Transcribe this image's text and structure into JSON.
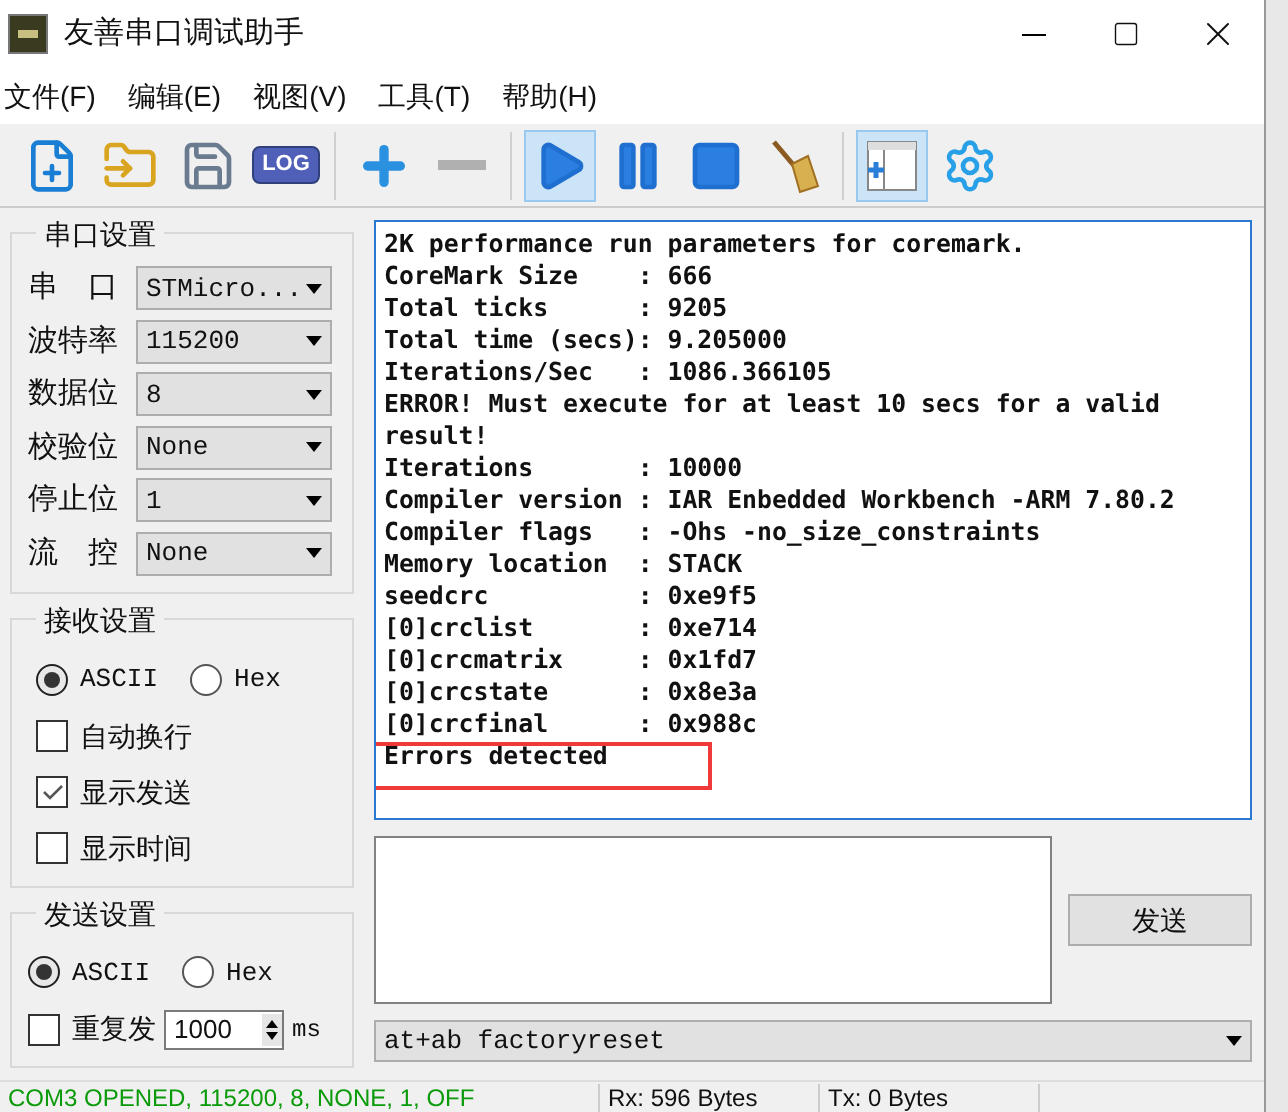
{
  "window": {
    "title": "友善串口调试助手"
  },
  "menu": [
    "文件(F)",
    "编辑(E)",
    "视图(V)",
    "工具(T)",
    "帮助(H)"
  ],
  "toolbar": [
    {
      "kind": "new",
      "selected": false
    },
    {
      "kind": "open",
      "selected": false
    },
    {
      "kind": "save",
      "selected": false
    },
    {
      "kind": "log",
      "label": "LOG",
      "selected": false
    },
    {
      "kind": "sep"
    },
    {
      "kind": "plus",
      "selected": false
    },
    {
      "kind": "minus",
      "selected": false
    },
    {
      "kind": "sep"
    },
    {
      "kind": "play",
      "selected": true
    },
    {
      "kind": "pause",
      "selected": false
    },
    {
      "kind": "stop",
      "selected": false
    },
    {
      "kind": "broom",
      "selected": false
    },
    {
      "kind": "sep"
    },
    {
      "kind": "layout",
      "selected": true
    },
    {
      "kind": "gear",
      "selected": false
    }
  ],
  "serial_settings": {
    "title": "串口设置",
    "fields": [
      {
        "label": "串　口",
        "value": "STMicro..."
      },
      {
        "label": "波特率",
        "value": "115200"
      },
      {
        "label": "数据位",
        "value": "8"
      },
      {
        "label": "校验位",
        "value": "None"
      },
      {
        "label": "停止位",
        "value": "1"
      },
      {
        "label": "流　控",
        "value": "None"
      }
    ]
  },
  "receive_settings": {
    "title": "接收设置",
    "modes": [
      {
        "label": "ASCII",
        "selected": true
      },
      {
        "label": "Hex",
        "selected": false
      }
    ],
    "options": [
      {
        "label": "自动换行",
        "checked": false
      },
      {
        "label": "显示发送",
        "checked": true
      },
      {
        "label": "显示时间",
        "checked": false
      }
    ]
  },
  "send_settings": {
    "title": "发送设置",
    "modes": [
      {
        "label": "ASCII",
        "selected": true
      },
      {
        "label": "Hex",
        "selected": false
      }
    ],
    "repeat": {
      "label": "重复发",
      "checked": false
    },
    "interval": "1000",
    "unit": "ms"
  },
  "receive_log": [
    "2K performance run parameters for coremark.",
    "CoreMark Size    : 666",
    "Total ticks      : 9205",
    "Total time (secs): 9.205000",
    "Iterations/Sec   : 1086.366105",
    "ERROR! Must execute for at least 10 secs for a valid",
    "result!",
    "Iterations       : 10000",
    "Compiler version : IAR Enbedded Workbench -ARM 7.80.2",
    "Compiler flags   : -Ohs -no_size_constraints",
    "Memory location  : STACK",
    "seedcrc          : 0xe9f5",
    "[0]crclist       : 0xe714",
    "[0]crcmatrix     : 0x1fd7",
    "[0]crcstate      : 0x8e3a",
    "[0]crcfinal      : 0x988c",
    "Errors detected"
  ],
  "send_button": "发送",
  "command": "at+ab factoryreset",
  "status_bar": [
    "COM3 OPENED, 115200, 8, NONE, 1, OFF",
    "Rx: 596 Bytes",
    "Tx: 0 Bytes"
  ]
}
